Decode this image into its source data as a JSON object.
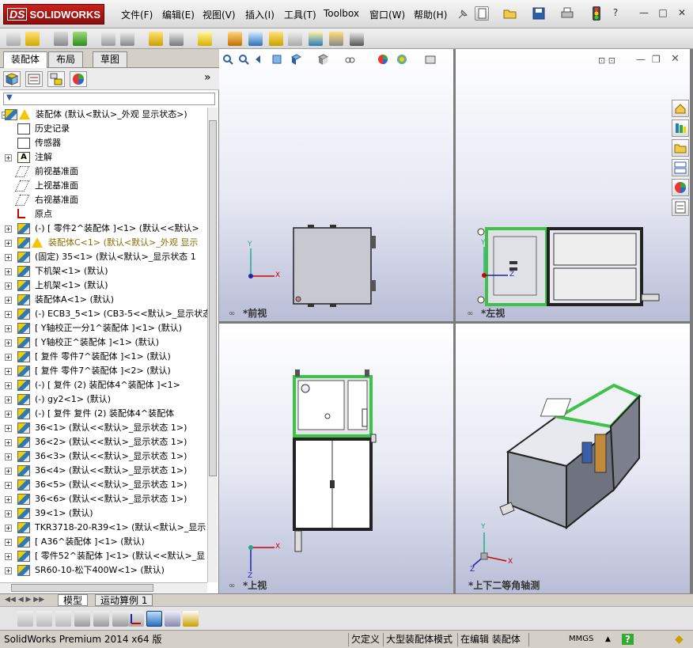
{
  "app": {
    "brand": "SOLIDWORKS",
    "brand_mark": "DS"
  },
  "menu": [
    {
      "label": "文件(F)"
    },
    {
      "label": "编辑(E)"
    },
    {
      "label": "视图(V)"
    },
    {
      "label": "插入(I)"
    },
    {
      "label": "工具(T)"
    },
    {
      "label": "Toolbox"
    },
    {
      "label": "窗口(W)"
    },
    {
      "label": "帮助(H)"
    }
  ],
  "window_controls": {
    "minimize": "—",
    "restore": "□",
    "close": "✕"
  },
  "panel": {
    "tabs": [
      "装配体",
      "布局",
      "草图"
    ],
    "expand_glyph": "»",
    "filter_glyph": "▼"
  },
  "tree": [
    {
      "label": "装配体   (默认<默认>_外观 显示状态>)",
      "icon": "assembly",
      "warn": true,
      "exp": "−",
      "indent": 0
    },
    {
      "label": "历史记录",
      "icon": "history",
      "indent": 1
    },
    {
      "label": "传感器",
      "icon": "sensor",
      "indent": 1
    },
    {
      "label": "注解",
      "icon": "note",
      "exp": "+",
      "indent": 1
    },
    {
      "label": "前视基准面",
      "icon": "plane",
      "indent": 1
    },
    {
      "label": "上视基准面",
      "icon": "plane",
      "indent": 1
    },
    {
      "label": "右视基准面",
      "icon": "plane",
      "indent": 1
    },
    {
      "label": "原点",
      "icon": "origin",
      "indent": 1
    },
    {
      "label": "(-) [ 零件2^装配体 ]<1> (默认<<默认>",
      "icon": "assembly",
      "exp": "+",
      "indent": 1
    },
    {
      "label": "装配体C<1> (默认<默认>_外观 显示",
      "icon": "assembly",
      "warn": true,
      "exp": "+",
      "indent": 1,
      "yellow": true
    },
    {
      "label": "(固定) 35<1> (默认<默认>_显示状态 1",
      "icon": "assembly",
      "exp": "+",
      "indent": 1
    },
    {
      "label": "下机架<1> (默认)",
      "icon": "assembly",
      "exp": "+",
      "indent": 1
    },
    {
      "label": "上机架<1> (默认)",
      "icon": "assembly",
      "exp": "+",
      "indent": 1
    },
    {
      "label": "装配体A<1> (默认)",
      "icon": "assembly",
      "exp": "+",
      "indent": 1
    },
    {
      "label": "(-) ECB3_5<1> (CB3-5<<默认>_显示状态",
      "icon": "assembly",
      "exp": "+",
      "indent": 1
    },
    {
      "label": "[ Y轴校正一分1^装配体 ]<1> (默认)",
      "icon": "assembly",
      "exp": "+",
      "indent": 1
    },
    {
      "label": "[ Y轴校正^装配体 ]<1> (默认)",
      "icon": "assembly",
      "exp": "+",
      "indent": 1
    },
    {
      "label": "[ 复件 零件7^装配体 ]<1> (默认)",
      "icon": "assembly",
      "exp": "+",
      "indent": 1
    },
    {
      "label": "[ 复件 零件7^装配体 ]<2> (默认)",
      "icon": "assembly",
      "exp": "+",
      "indent": 1
    },
    {
      "label": "(-) [ 复件 (2) 装配体4^装配体 ]<1>",
      "icon": "assembly",
      "exp": "+",
      "indent": 1
    },
    {
      "label": "(-) gy2<1> (默认)",
      "icon": "assembly",
      "exp": "+",
      "indent": 1
    },
    {
      "label": "(-) [ 复件 复件 (2) 装配体4^装配体",
      "icon": "assembly",
      "exp": "+",
      "indent": 1
    },
    {
      "label": "36<1> (默认<<默认>_显示状态 1>)",
      "icon": "assembly",
      "exp": "+",
      "indent": 1
    },
    {
      "label": "36<2> (默认<<默认>_显示状态 1>)",
      "icon": "assembly",
      "exp": "+",
      "indent": 1
    },
    {
      "label": "36<3> (默认<<默认>_显示状态 1>)",
      "icon": "assembly",
      "exp": "+",
      "indent": 1
    },
    {
      "label": "36<4> (默认<<默认>_显示状态 1>)",
      "icon": "assembly",
      "exp": "+",
      "indent": 1
    },
    {
      "label": "36<5> (默认<<默认>_显示状态 1>)",
      "icon": "assembly",
      "exp": "+",
      "indent": 1
    },
    {
      "label": "36<6> (默认<<默认>_显示状态 1>)",
      "icon": "assembly",
      "exp": "+",
      "indent": 1
    },
    {
      "label": "39<1> (默认)",
      "icon": "assembly",
      "exp": "+",
      "indent": 1
    },
    {
      "label": "TKR3718-20-R39<1> (默认<默认>_显示",
      "icon": "assembly",
      "exp": "+",
      "indent": 1
    },
    {
      "label": "[ A36^装配体 ]<1> (默认)",
      "icon": "assembly",
      "exp": "+",
      "indent": 1
    },
    {
      "label": "[ 零件52^装配体 ]<1> (默认<<默认>_显",
      "icon": "assembly",
      "exp": "+",
      "indent": 1
    },
    {
      "label": "SR60-10-松下400W<1> (默认)",
      "icon": "assembly",
      "exp": "+",
      "indent": 1
    }
  ],
  "viewports": [
    {
      "label": "*前视"
    },
    {
      "label": "*左视"
    },
    {
      "label": "*上视"
    },
    {
      "label": "*上下二等角轴测"
    }
  ],
  "axes": {
    "x": "X",
    "y": "Y",
    "z": "Z"
  },
  "model_tabs": [
    "模型",
    "运动算例 1"
  ],
  "status": {
    "product": "SolidWorks Premium 2014 x64 版",
    "under_defined": "欠定义",
    "large_asm": "大型装配体模式",
    "editing": "在编辑 装配体",
    "units": "MMGS",
    "help": "?"
  }
}
